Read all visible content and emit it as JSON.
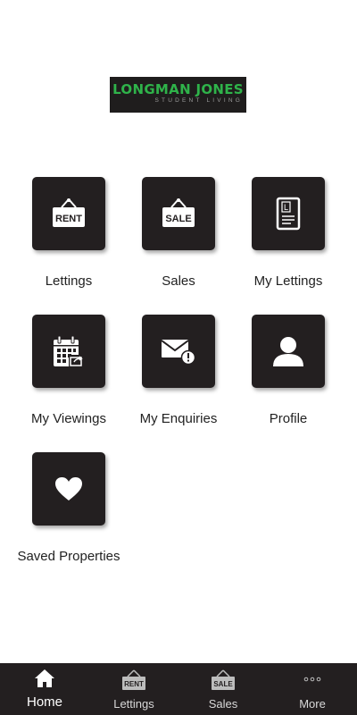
{
  "logo": {
    "title": "LONGMAN JONES",
    "subtitle": "STUDENT LIVING"
  },
  "menu": {
    "tiles": [
      {
        "label": "Lettings",
        "icon": "rent-sign-icon"
      },
      {
        "label": "Sales",
        "icon": "sale-sign-icon"
      },
      {
        "label": "My Lettings",
        "icon": "document-icon"
      },
      {
        "label": "My Viewings",
        "icon": "calendar-share-icon"
      },
      {
        "label": "My Enquiries",
        "icon": "mail-alert-icon"
      },
      {
        "label": "Profile",
        "icon": "user-icon"
      },
      {
        "label": "Saved Properties",
        "icon": "heart-icon"
      }
    ],
    "rent_sign_text": "RENT",
    "sale_sign_text": "SALE",
    "document_letter": "L"
  },
  "nav": {
    "items": [
      {
        "label": "Home",
        "icon": "home-icon",
        "active": true
      },
      {
        "label": "Lettings",
        "icon": "rent-sign-icon",
        "active": false
      },
      {
        "label": "Sales",
        "icon": "sale-sign-icon",
        "active": false
      },
      {
        "label": "More",
        "icon": "more-dots-icon",
        "active": false
      }
    ]
  },
  "colors": {
    "tile_background": "#231f20",
    "brand_green": "#2fb34a",
    "nav_background": "#231f20"
  }
}
